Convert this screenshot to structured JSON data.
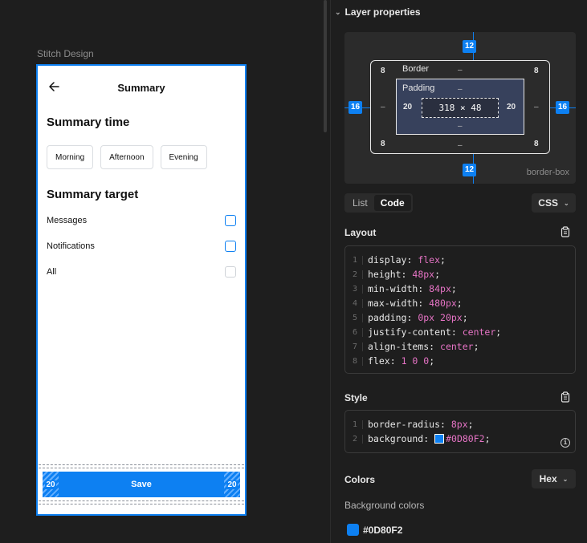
{
  "canvas": {
    "frame_label": "Stitch Design",
    "phone": {
      "title": "Summary",
      "summary_time_heading": "Summary time",
      "time_options": [
        "Morning",
        "Afternoon",
        "Evening"
      ],
      "summary_target_heading": "Summary target",
      "targets": [
        {
          "label": "Messages",
          "checked": false
        },
        {
          "label": "Notifications",
          "checked": false
        },
        {
          "label": "All",
          "checked": false
        }
      ],
      "save_label": "Save",
      "padding_left_tag": "20",
      "padding_right_tag": "20"
    }
  },
  "panel": {
    "header": "Layer properties",
    "box_model": {
      "margin_top": "12",
      "margin_bottom": "12",
      "margin_left": "16",
      "margin_right": "16",
      "border_label": "Border",
      "border_top_left": "8",
      "border_top_right": "8",
      "border_bottom_left": "8",
      "border_bottom_right": "8",
      "border_top": "–",
      "border_bottom": "–",
      "border_left": "–",
      "border_right": "–",
      "padding_label": "Padding",
      "padding_top": "–",
      "padding_bottom": "–",
      "padding_left": "20",
      "padding_right": "20",
      "content_size": "318 × 48",
      "box_sizing": "border-box"
    },
    "view_tabs": [
      "List",
      "Code"
    ],
    "active_view_tab": "Code",
    "format_dropdown": "CSS",
    "layout": {
      "title": "Layout",
      "lines": [
        {
          "n": "1",
          "prop": "display",
          "val": "flex"
        },
        {
          "n": "2",
          "prop": "height",
          "val": "48px"
        },
        {
          "n": "3",
          "prop": "min-width",
          "val": "84px"
        },
        {
          "n": "4",
          "prop": "max-width",
          "val": "480px"
        },
        {
          "n": "5",
          "prop": "padding",
          "val": "0px 20px"
        },
        {
          "n": "6",
          "prop": "justify-content",
          "val": "center"
        },
        {
          "n": "7",
          "prop": "align-items",
          "val": "center"
        },
        {
          "n": "8",
          "prop": "flex",
          "val": "1 0 0"
        }
      ]
    },
    "style": {
      "title": "Style",
      "lines": [
        {
          "n": "1",
          "prop": "border-radius",
          "val": "8px"
        },
        {
          "n": "2",
          "prop": "background",
          "val": "#0D80F2"
        }
      ]
    },
    "colors": {
      "title": "Colors",
      "format_dropdown": "Hex",
      "background_label": "Background colors",
      "items": [
        {
          "hex": "#0D80F2"
        }
      ]
    }
  },
  "theme": {
    "accent": "#0d80f2",
    "code_value": "#e774c6",
    "panel_bg": "#1e1e1e"
  }
}
